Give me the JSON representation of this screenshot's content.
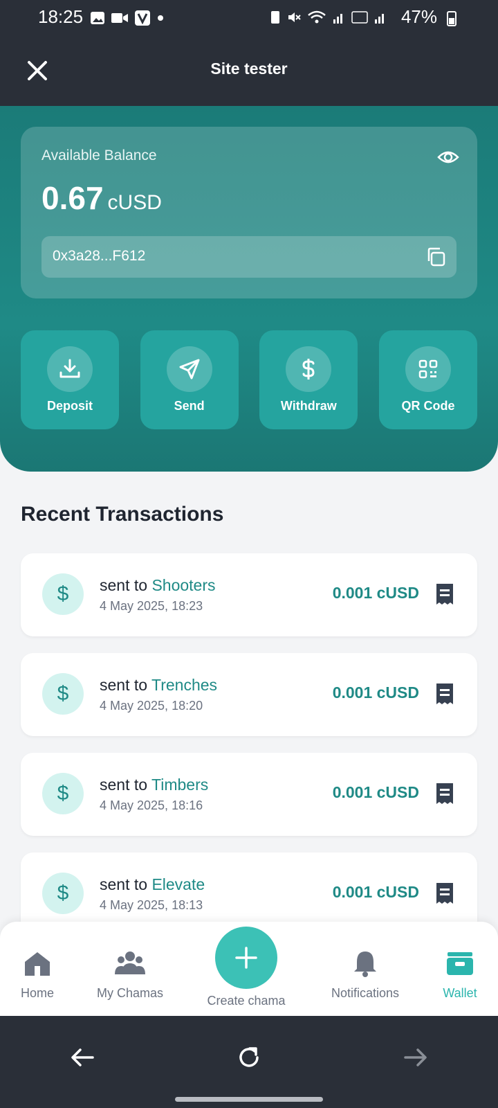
{
  "status_bar": {
    "time": "18:25",
    "battery_pct": "47%"
  },
  "app_bar": {
    "title": "Site tester"
  },
  "balance": {
    "label": "Available Balance",
    "amount": "0.67",
    "currency": "cUSD",
    "address": "0x3a28...F612"
  },
  "actions": [
    {
      "label": "Deposit",
      "icon": "download-icon"
    },
    {
      "label": "Send",
      "icon": "send-icon"
    },
    {
      "label": "Withdraw",
      "icon": "dollar-icon"
    },
    {
      "label": "QR Code",
      "icon": "qr-code-icon"
    }
  ],
  "transactions": {
    "title": "Recent Transactions",
    "items": [
      {
        "prefix": "sent to ",
        "name": "Shooters",
        "date": "4 May 2025, 18:23",
        "amount": "0.001 cUSD"
      },
      {
        "prefix": "sent to ",
        "name": "Trenches",
        "date": "4 May 2025, 18:20",
        "amount": "0.001 cUSD"
      },
      {
        "prefix": "sent to ",
        "name": "Timbers",
        "date": "4 May 2025, 18:16",
        "amount": "0.001 cUSD"
      },
      {
        "prefix": "sent to ",
        "name": "Elevate",
        "date": "4 May 2025, 18:13",
        "amount": "0.001 cUSD"
      }
    ]
  },
  "tab_bar": {
    "home": "Home",
    "chamas": "My Chamas",
    "create": "Create chama",
    "notifications": "Notifications",
    "wallet": "Wallet"
  },
  "colors": {
    "accent": "#1f8a86",
    "active_tab": "#2bb5ad",
    "fab": "#3cc1b6",
    "dark": "#2a2f38"
  }
}
